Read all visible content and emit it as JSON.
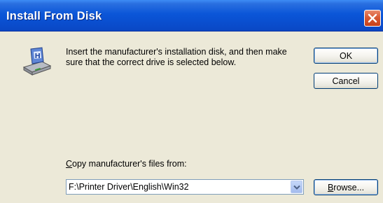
{
  "window": {
    "title": "Install From Disk"
  },
  "dialog": {
    "instructions": "Insert the manufacturer's installation disk, and then make sure that the correct drive is selected below.",
    "ok_label": "OK",
    "cancel_label": "Cancel",
    "copy_label_mnemonic": "C",
    "copy_label_rest": "opy manufacturer's files from:",
    "path_value": "F:\\Printer Driver\\English\\Win32",
    "browse_mnemonic": "B",
    "browse_rest": "rowse..."
  },
  "icons": {
    "disk": "install-disk-icon",
    "close": "close-icon",
    "dropdown": "chevron-down-icon"
  },
  "colors": {
    "titlebar": "#0b56d8",
    "close": "#d85a35",
    "dialog_bg": "#ece9d8"
  }
}
